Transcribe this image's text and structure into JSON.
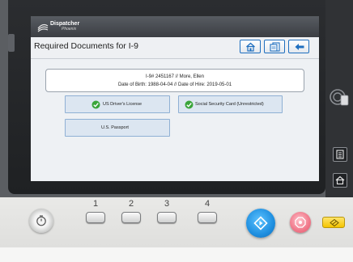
{
  "app": {
    "logo_text": "Dispatcher",
    "logo_sub": "Phoenix"
  },
  "header": {
    "title": "Required Documents for I-9",
    "nav": [
      {
        "icon": "home-icon"
      },
      {
        "icon": "document-icon"
      },
      {
        "icon": "back-arrow-icon"
      }
    ]
  },
  "employee": {
    "line1": "I-9# 2451167  //  More, Ellen",
    "line2": "Date of Birth: 1988-04-04  //  Date of Hire: 2019-05-01"
  },
  "documents": [
    {
      "label": "US Driver's License",
      "checked": true
    },
    {
      "label": "Social Security Card (Unrestricted)",
      "checked": true
    },
    {
      "label": "U.S. Passport",
      "checked": false
    }
  ],
  "keypad": [
    "1",
    "2",
    "3",
    "4"
  ],
  "colors": {
    "accent": "#1f6fbf",
    "check_green": "#3aa53a",
    "start_blue": "#1f8fe0",
    "stop_pink": "#f0788a",
    "reset_yellow": "#f5c400"
  }
}
